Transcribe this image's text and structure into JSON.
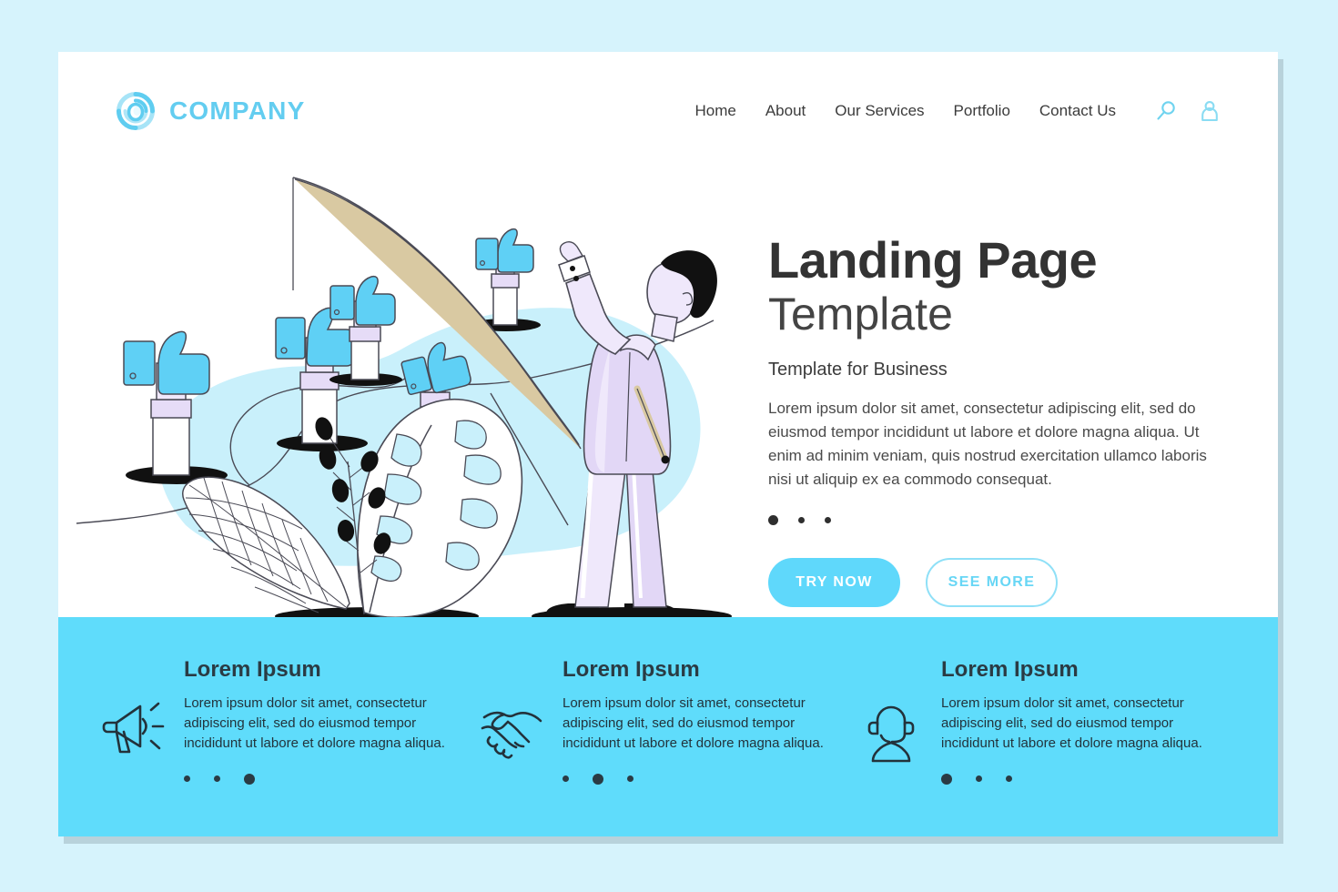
{
  "brand": {
    "name": "COMPANY",
    "logo_icon": "swirl-circle-logo",
    "color": "#63cdf0"
  },
  "nav": {
    "items": [
      {
        "label": "Home"
      },
      {
        "label": "About"
      },
      {
        "label": "Our Services"
      },
      {
        "label": "Portfolio"
      },
      {
        "label": "Contact Us"
      }
    ],
    "icons": [
      {
        "name": "search-icon"
      },
      {
        "name": "user-account-icon"
      }
    ]
  },
  "hero": {
    "title_main": "Landing Page",
    "title_sub": "Template",
    "tagline": "Template for Business",
    "body": "Lorem ipsum dolor sit amet, consectetur adipiscing elit, sed do eiusmod tempor incididunt ut labore et dolore magna aliqua. Ut enim ad minim veniam, quis nostrud exercitation ullamco laboris nisi ut aliquip ex ea commodo consequat.",
    "carousel_dots": [
      {
        "active": true
      },
      {
        "active": false
      },
      {
        "active": false
      }
    ],
    "buttons": {
      "primary": "TRY NOW",
      "secondary": "SEE MORE"
    },
    "illustration": {
      "name": "businessman-fishing-for-likes",
      "blob_color": "#c9f0fb",
      "suit_color": "#e6dcf7",
      "thumb_color": "#5fd0f5"
    }
  },
  "features": {
    "background_color": "#5fdcfb",
    "items": [
      {
        "icon": "megaphone-icon",
        "title": "Lorem Ipsum",
        "text": "Lorem ipsum dolor sit amet, consectetur adipiscing elit, sed do eiusmod tempor incididunt ut labore et dolore magna aliqua.",
        "dots": [
          {
            "active": false
          },
          {
            "active": false
          },
          {
            "active": true
          }
        ]
      },
      {
        "icon": "handshake-icon",
        "title": "Lorem Ipsum",
        "text": "Lorem ipsum dolor sit amet, consectetur adipiscing elit, sed do eiusmod tempor incididunt ut labore et dolore magna aliqua.",
        "dots": [
          {
            "active": false
          },
          {
            "active": true
          },
          {
            "active": false
          }
        ]
      },
      {
        "icon": "headset-support-icon",
        "title": "Lorem Ipsum",
        "text": "Lorem ipsum dolor sit amet, consectetur adipiscing elit, sed do eiusmod tempor incididunt ut labore et dolore magna aliqua.",
        "dots": [
          {
            "active": true
          },
          {
            "active": false
          },
          {
            "active": false
          }
        ]
      }
    ]
  },
  "theme": {
    "page_background": "#d6f3fc",
    "card_background": "#ffffff",
    "accent": "#5fd8fb",
    "text_dark": "#333333"
  }
}
